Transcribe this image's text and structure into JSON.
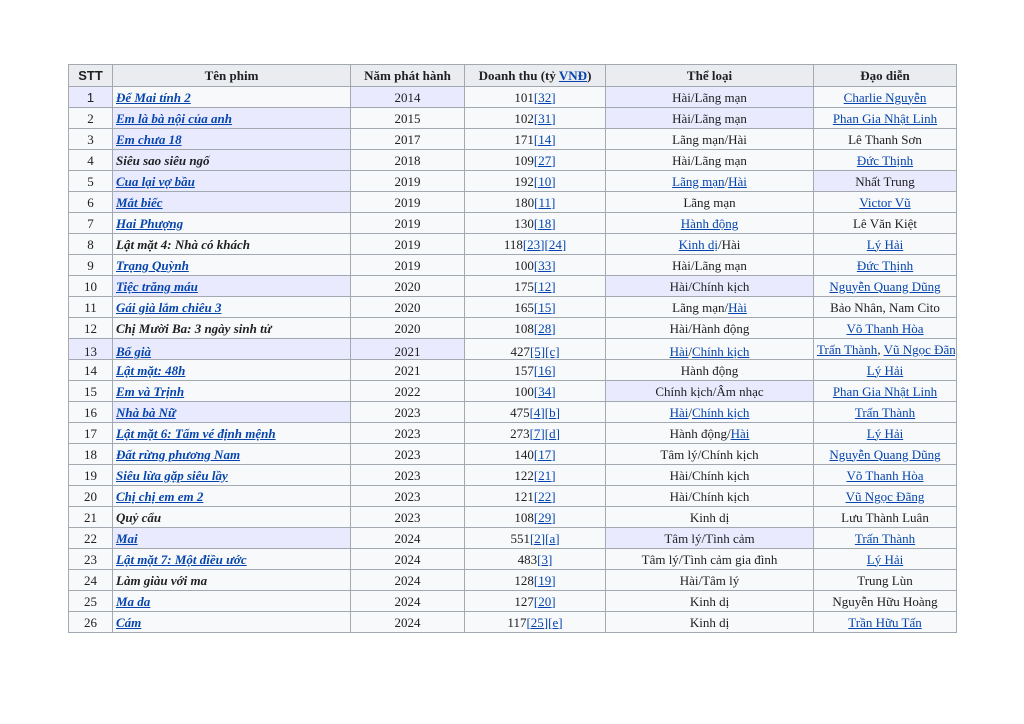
{
  "headers": {
    "stt": "STT",
    "title": "Tên phim",
    "year": "Năm phát hành",
    "revenue_prefix": "Doanh thu (tỷ ",
    "revenue_link": "VNĐ",
    "revenue_suffix": ")",
    "genre": "Thể loại",
    "director": "Đạo diễn"
  },
  "colors": {
    "header_bg": "#eaecf0",
    "cell_bg": "#f8f9fa",
    "highlight_bg": "#eaeaff",
    "link": "#0645ad",
    "border": "#a2a9b1"
  },
  "rows": [
    {
      "stt": "1",
      "title": "Để Mai tính 2",
      "title_link": true,
      "year": "2014",
      "revenue": [
        [
          "101",
          false
        ],
        [
          "[32]",
          true
        ]
      ],
      "genre": [
        [
          "Hài/Lãng mạn",
          false
        ]
      ],
      "director": [
        [
          "Charlie Nguyễn",
          true
        ]
      ],
      "hl": [
        "stt",
        "year",
        "genre"
      ]
    },
    {
      "stt": "2",
      "title": "Em là bà nội của anh",
      "title_link": true,
      "year": "2015",
      "revenue": [
        [
          "102",
          false
        ],
        [
          "[31]",
          true
        ]
      ],
      "genre": [
        [
          "Hài/Lãng mạn",
          false
        ]
      ],
      "director": [
        [
          "Phan Gia Nhật Linh",
          true
        ]
      ],
      "hl": [
        "title",
        "genre"
      ]
    },
    {
      "stt": "3",
      "title": "Em chưa 18",
      "title_link": true,
      "year": "2017",
      "revenue": [
        [
          "171",
          false
        ],
        [
          "[14]",
          true
        ]
      ],
      "genre": [
        [
          "Lãng mạn/Hài",
          false
        ]
      ],
      "director": [
        [
          "Lê Thanh Sơn",
          false
        ]
      ],
      "hl": [
        "title"
      ]
    },
    {
      "stt": "4",
      "title": "Siêu sao siêu ngố",
      "title_link": false,
      "year": "2018",
      "revenue": [
        [
          "109",
          false
        ],
        [
          "[27]",
          true
        ]
      ],
      "genre": [
        [
          "Hài/Lãng mạn",
          false
        ]
      ],
      "director": [
        [
          "Đức Thịnh",
          true
        ]
      ],
      "hl": [
        "title"
      ]
    },
    {
      "stt": "5",
      "title": "Cua lại vợ bầu",
      "title_link": true,
      "year": "2019",
      "revenue": [
        [
          "192",
          false
        ],
        [
          "[10]",
          true
        ]
      ],
      "genre": [
        [
          "Lãng mạn",
          true
        ],
        [
          "/",
          false
        ],
        [
          "Hài",
          true
        ]
      ],
      "director": [
        [
          "Nhất Trung",
          false
        ]
      ],
      "hl": [
        "title",
        "director"
      ]
    },
    {
      "stt": "6",
      "title": "Mắt biếc",
      "title_link": true,
      "year": "2019",
      "revenue": [
        [
          "180",
          false
        ],
        [
          "[11]",
          true
        ]
      ],
      "genre": [
        [
          "Lãng mạn",
          false
        ]
      ],
      "director": [
        [
          "Victor Vũ",
          true
        ]
      ],
      "hl": [
        "title"
      ]
    },
    {
      "stt": "7",
      "title": "Hai Phượng",
      "title_link": true,
      "year": "2019",
      "revenue": [
        [
          "130",
          false
        ],
        [
          "[18]",
          true
        ]
      ],
      "genre": [
        [
          "Hành động",
          true
        ]
      ],
      "director": [
        [
          "Lê Văn Kiệt",
          false
        ]
      ],
      "hl": []
    },
    {
      "stt": "8",
      "title": "Lật mặt 4: Nhà có khách",
      "title_link": false,
      "year": "2019",
      "revenue": [
        [
          "118",
          false
        ],
        [
          "[23]",
          true
        ],
        [
          "[24]",
          true
        ]
      ],
      "genre": [
        [
          "Kinh dị",
          true
        ],
        [
          "/Hài",
          false
        ]
      ],
      "director": [
        [
          "Lý Hải",
          true
        ]
      ],
      "hl": []
    },
    {
      "stt": "9",
      "title": "Trạng Quỳnh",
      "title_link": true,
      "year": "2019",
      "revenue": [
        [
          "100",
          false
        ],
        [
          "[33]",
          true
        ]
      ],
      "genre": [
        [
          "Hài/Lãng mạn",
          false
        ]
      ],
      "director": [
        [
          "Đức Thịnh",
          true
        ]
      ],
      "hl": []
    },
    {
      "stt": "10",
      "title": "Tiệc trăng máu",
      "title_link": true,
      "year": "2020",
      "revenue": [
        [
          "175",
          false
        ],
        [
          "[12]",
          true
        ]
      ],
      "genre": [
        [
          "Hài/Chính kịch",
          false
        ]
      ],
      "director": [
        [
          "Nguyễn Quang Dũng",
          true
        ]
      ],
      "hl": [
        "title",
        "genre"
      ]
    },
    {
      "stt": "11",
      "title": "Gái già lắm chiêu 3",
      "title_link": true,
      "year": "2020",
      "revenue": [
        [
          "165",
          false
        ],
        [
          "[15]",
          true
        ]
      ],
      "genre": [
        [
          "Lãng mạn/",
          false
        ],
        [
          "Hài",
          true
        ]
      ],
      "director": [
        [
          "Bảo Nhân, Nam Cito",
          false
        ]
      ],
      "hl": []
    },
    {
      "stt": "12",
      "title": "Chị Mười Ba: 3 ngày sinh tử",
      "title_link": false,
      "year": "2020",
      "revenue": [
        [
          "108",
          false
        ],
        [
          "[28]",
          true
        ]
      ],
      "genre": [
        [
          "Hài/Hành động",
          false
        ]
      ],
      "director": [
        [
          "Võ Thanh Hòa",
          true
        ]
      ],
      "hl": []
    },
    {
      "stt": "13",
      "title": "Bố già",
      "title_link": true,
      "year": "2021",
      "revenue": [
        [
          "427",
          false
        ],
        [
          "[5]",
          true
        ],
        [
          "[c]",
          true
        ]
      ],
      "genre": [
        [
          "Hài",
          true
        ],
        [
          "/",
          false
        ],
        [
          "Chính kịch",
          true
        ]
      ],
      "director": [
        [
          "Trấn Thành",
          true
        ],
        [
          ", ",
          false
        ],
        [
          "Vũ Ngọc Đãng",
          true
        ]
      ],
      "hl": [
        "stt",
        "title",
        "year"
      ],
      "tall": true
    },
    {
      "stt": "14",
      "title": "Lật mặt: 48h",
      "title_link": true,
      "year": "2021",
      "revenue": [
        [
          "157",
          false
        ],
        [
          "[16]",
          true
        ]
      ],
      "genre": [
        [
          "Hành động",
          false
        ]
      ],
      "director": [
        [
          "Lý Hải",
          true
        ]
      ],
      "hl": []
    },
    {
      "stt": "15",
      "title": "Em và Trịnh",
      "title_link": true,
      "year": "2022",
      "revenue": [
        [
          "100",
          false
        ],
        [
          "[34]",
          true
        ]
      ],
      "genre": [
        [
          "Chính kịch/Âm nhạc",
          false
        ]
      ],
      "director": [
        [
          "Phan Gia Nhật Linh",
          true
        ]
      ],
      "hl": [
        "genre"
      ]
    },
    {
      "stt": "16",
      "title": "Nhà bà Nữ",
      "title_link": true,
      "year": "2023",
      "revenue": [
        [
          "475",
          false
        ],
        [
          "[4]",
          true
        ],
        [
          "[b]",
          true
        ]
      ],
      "genre": [
        [
          "Hài",
          true
        ],
        [
          "/",
          false
        ],
        [
          "Chính kịch",
          true
        ]
      ],
      "director": [
        [
          "Trấn Thành",
          true
        ]
      ],
      "hl": [
        "title"
      ]
    },
    {
      "stt": "17",
      "title": "Lật mặt 6: Tấm vé định mệnh",
      "title_link": true,
      "year": "2023",
      "revenue": [
        [
          "273",
          false
        ],
        [
          "[7]",
          true
        ],
        [
          "[d]",
          true
        ]
      ],
      "genre": [
        [
          "Hành động/",
          false
        ],
        [
          "Hài",
          true
        ]
      ],
      "director": [
        [
          "Lý Hải",
          true
        ]
      ],
      "hl": []
    },
    {
      "stt": "18",
      "title": "Đất rừng phương Nam",
      "title_link": true,
      "year": "2023",
      "revenue": [
        [
          "140",
          false
        ],
        [
          "[17]",
          true
        ]
      ],
      "genre": [
        [
          "Tâm lý/Chính kịch",
          false
        ]
      ],
      "director": [
        [
          "Nguyễn Quang Dũng",
          true
        ]
      ],
      "hl": []
    },
    {
      "stt": "19",
      "title": "Siêu lừa gặp siêu lầy",
      "title_link": true,
      "year": "2023",
      "revenue": [
        [
          "122",
          false
        ],
        [
          "[21]",
          true
        ]
      ],
      "genre": [
        [
          "Hài/Chính kịch",
          false
        ]
      ],
      "director": [
        [
          "Võ Thanh Hòa",
          true
        ]
      ],
      "hl": []
    },
    {
      "stt": "20",
      "title": "Chị chị em em 2",
      "title_link": true,
      "year": "2023",
      "revenue": [
        [
          "121",
          false
        ],
        [
          "[22]",
          true
        ]
      ],
      "genre": [
        [
          "Hài/Chính kịch",
          false
        ]
      ],
      "director": [
        [
          "Vũ Ngọc Đãng",
          true
        ]
      ],
      "hl": []
    },
    {
      "stt": "21",
      "title": "Quỷ cẩu",
      "title_link": false,
      "year": "2023",
      "revenue": [
        [
          "108",
          false
        ],
        [
          "[29]",
          true
        ]
      ],
      "genre": [
        [
          "Kinh dị",
          false
        ]
      ],
      "director": [
        [
          "Lưu Thành Luân",
          false
        ]
      ],
      "hl": []
    },
    {
      "stt": "22",
      "title": "Mai",
      "title_link": true,
      "year": "2024",
      "revenue": [
        [
          "551",
          false
        ],
        [
          "[2]",
          true
        ],
        [
          "[a]",
          true
        ]
      ],
      "genre": [
        [
          "Tâm lý/Tình cảm",
          false
        ]
      ],
      "director": [
        [
          "Trấn Thành",
          true
        ]
      ],
      "hl": [
        "title",
        "genre"
      ]
    },
    {
      "stt": "23",
      "title": "Lật mặt 7: Một điều ước",
      "title_link": true,
      "year": "2024",
      "revenue": [
        [
          "483",
          false
        ],
        [
          "[3]",
          true
        ]
      ],
      "genre": [
        [
          "Tâm lý/Tình cảm gia đình",
          false
        ]
      ],
      "director": [
        [
          "Lý Hải",
          true
        ]
      ],
      "hl": []
    },
    {
      "stt": "24",
      "title": "Làm giàu với ma",
      "title_link": false,
      "year": "2024",
      "revenue": [
        [
          "128",
          false
        ],
        [
          "[19]",
          true
        ]
      ],
      "genre": [
        [
          "Hài/Tâm lý",
          false
        ]
      ],
      "director": [
        [
          "Trung Lùn",
          false
        ]
      ],
      "hl": []
    },
    {
      "stt": "25",
      "title": "Ma da",
      "title_link": true,
      "year": "2024",
      "revenue": [
        [
          "127",
          false
        ],
        [
          "[20]",
          true
        ]
      ],
      "genre": [
        [
          "Kinh dị",
          false
        ]
      ],
      "director": [
        [
          "Nguyễn Hữu Hoàng",
          false
        ]
      ],
      "hl": []
    },
    {
      "stt": "26",
      "title": "Cám",
      "title_link": true,
      "year": "2024",
      "revenue": [
        [
          "117",
          false
        ],
        [
          "[25]",
          true
        ],
        [
          "[e]",
          true
        ]
      ],
      "genre": [
        [
          "Kinh dị",
          false
        ]
      ],
      "director": [
        [
          "Trần Hữu Tấn",
          true
        ]
      ],
      "hl": []
    }
  ]
}
